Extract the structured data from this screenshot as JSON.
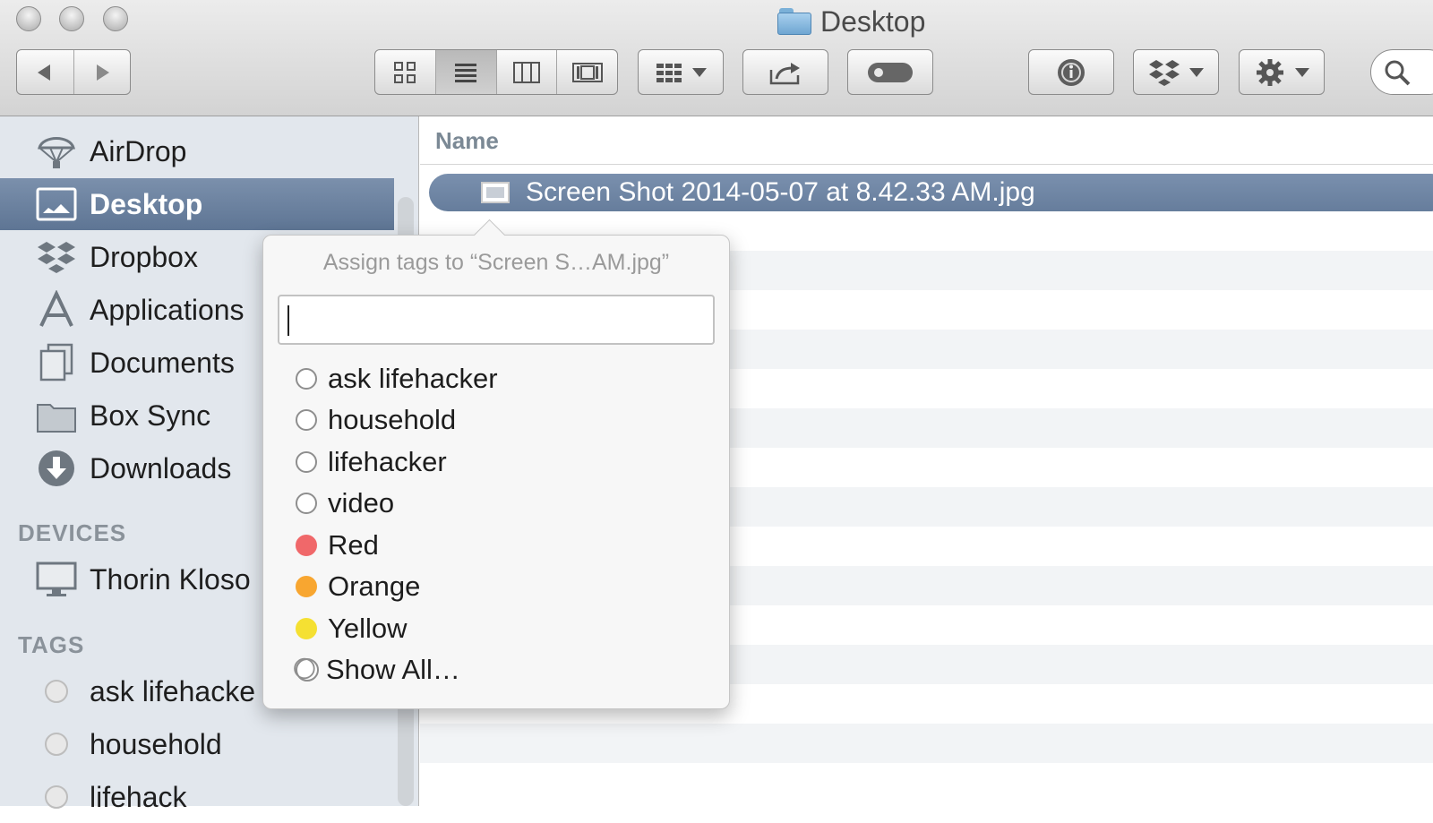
{
  "window": {
    "title": "Desktop"
  },
  "toolbar": {
    "back_icon": "back-arrow-icon",
    "forward_icon": "forward-arrow-icon",
    "view_modes": [
      "icon-view",
      "list-view",
      "column-view",
      "cover-flow-view"
    ],
    "active_view": "list-view"
  },
  "sidebar": {
    "favorites": [
      {
        "label": "AirDrop",
        "icon": "airdrop-icon"
      },
      {
        "label": "Desktop",
        "icon": "desktop-icon",
        "selected": true
      },
      {
        "label": "Dropbox",
        "icon": "dropbox-icon"
      },
      {
        "label": "Applications",
        "icon": "applications-icon"
      },
      {
        "label": "Documents",
        "icon": "documents-icon"
      },
      {
        "label": "Box Sync",
        "icon": "folder-icon"
      },
      {
        "label": "Downloads",
        "icon": "downloads-icon"
      }
    ],
    "devices_header": "DEVICES",
    "devices": [
      {
        "label": "Thorin Kloso",
        "icon": "computer-icon"
      }
    ],
    "tags_header": "TAGS",
    "tags": [
      {
        "label": "ask lifehacke"
      },
      {
        "label": "household"
      },
      {
        "label": "lifehack"
      }
    ]
  },
  "list": {
    "column_name": "Name",
    "selected_file": "Screen Shot 2014-05-07 at 8.42.33 AM.jpg"
  },
  "popover": {
    "title": "Assign tags to “Screen S…AM.jpg”",
    "input_value": "",
    "tags": [
      {
        "label": "ask lifehacker",
        "color": ""
      },
      {
        "label": "household",
        "color": ""
      },
      {
        "label": "lifehacker",
        "color": ""
      },
      {
        "label": "video",
        "color": ""
      },
      {
        "label": "Red",
        "color": "#f0686a"
      },
      {
        "label": "Orange",
        "color": "#f8a630"
      },
      {
        "label": "Yellow",
        "color": "#f5e032"
      }
    ],
    "show_all": "Show All…"
  },
  "colors": {
    "selection": "#6b82a1",
    "sidebar_bg": "#e2e7ed"
  }
}
